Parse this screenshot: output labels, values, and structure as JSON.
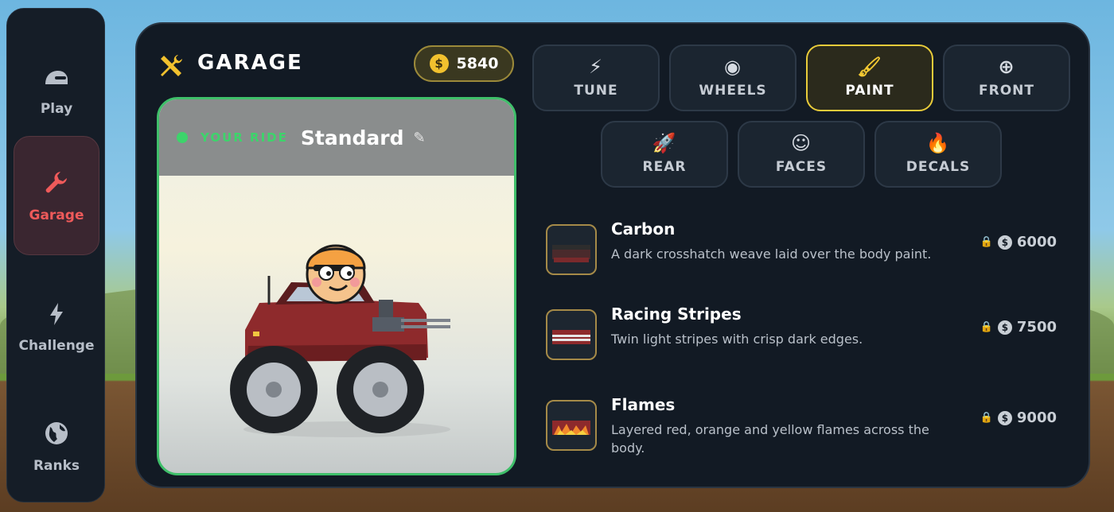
{
  "nav": {
    "items": [
      {
        "label": "Play",
        "icon": "helmet-icon",
        "glyph": "◒"
      },
      {
        "label": "Garage",
        "icon": "wrench-icon",
        "glyph": "🔧"
      },
      {
        "label": "Challenge",
        "icon": "lightning-icon",
        "glyph": "⚡"
      },
      {
        "label": "Ranks",
        "icon": "globe-icon",
        "glyph": "🌍"
      }
    ],
    "active": "Garage"
  },
  "header": {
    "title": "GARAGE",
    "icon": "tools-icon"
  },
  "coins": {
    "symbol": "$",
    "amount": "5840"
  },
  "ride": {
    "label": "YOUR RIDE",
    "name": "Standard",
    "edit_icon": "pencil-icon"
  },
  "tabs": [
    {
      "label": "TUNE",
      "icon": "lightning-icon",
      "glyph": "⚡"
    },
    {
      "label": "WHEELS",
      "icon": "wheel-icon",
      "glyph": "◉"
    },
    {
      "label": "PAINT",
      "icon": "paint-roller-icon",
      "glyph": "🖌"
    },
    {
      "label": "FRONT",
      "icon": "target-icon",
      "glyph": "⊕"
    },
    {
      "label": "REAR",
      "icon": "rocket-icon",
      "glyph": "🚀"
    },
    {
      "label": "FACES",
      "icon": "face-icon",
      "glyph": "☺"
    },
    {
      "label": "DECALS",
      "icon": "fire-icon",
      "glyph": "🔥"
    }
  ],
  "active_tab": "PAINT",
  "items": [
    {
      "name": "Carbon",
      "desc": "A dark crosshatch weave laid over the body paint.",
      "price": "6000",
      "locked": true
    },
    {
      "name": "Racing Stripes",
      "desc": "Twin light stripes with crisp dark edges.",
      "price": "7500",
      "locked": true
    },
    {
      "name": "Flames",
      "desc": "Layered red, orange and yellow flames across the body.",
      "price": "9000",
      "locked": true
    }
  ],
  "colors": {
    "accent_green": "#3dd46b",
    "accent_yellow": "#e8cb3a",
    "accent_red": "#ef5a5a",
    "panel": "#121a24"
  }
}
